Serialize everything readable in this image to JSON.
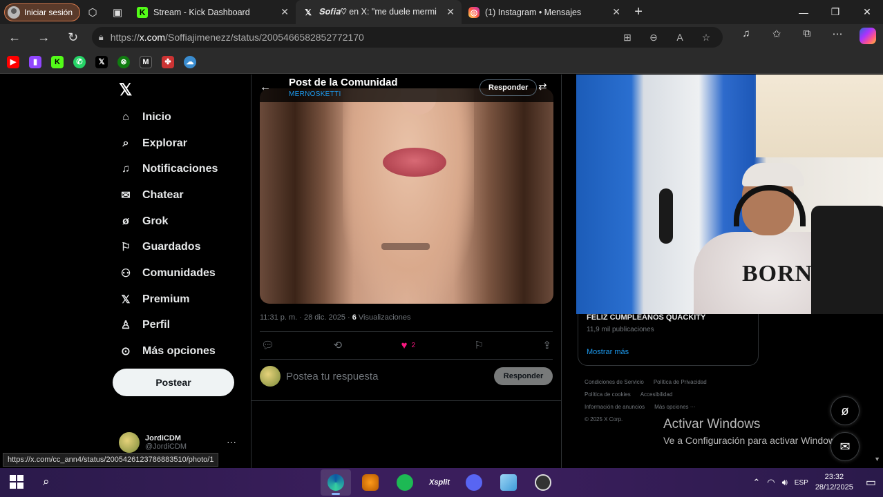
{
  "browser": {
    "profile_label": "Iniciar sesión",
    "tabs": [
      {
        "title": "Stream - Kick Dashboard",
        "favicon": "kick-icon",
        "active": false
      },
      {
        "title": "𝑺𝒐𝒇𝒊𝒂♡︎ en X: \"me duele mermi",
        "favicon": "x-icon",
        "active": true
      },
      {
        "title": "(1) Instagram • Mensajes",
        "favicon": "instagram-icon",
        "active": false
      }
    ],
    "url_prefix": "https://",
    "url_host": "x.com",
    "url_path": "/Soffiajimenezz/status/2005466582852772170",
    "bookmarks": [
      "youtube-icon",
      "twitch-icon",
      "kick-icon",
      "whatsapp-icon",
      "x-icon",
      "xbox-icon",
      "m-icon",
      "puzzle-icon",
      "cloud-icon"
    ],
    "status_url": "https://x.com/cc_ann4/status/2005426123786883510/photo/1"
  },
  "sidebar": {
    "items": [
      {
        "label": "Inicio",
        "icon": "home-icon"
      },
      {
        "label": "Explorar",
        "icon": "search-icon"
      },
      {
        "label": "Notificaciones",
        "icon": "bell-icon"
      },
      {
        "label": "Chatear",
        "icon": "mail-icon"
      },
      {
        "label": "Grok",
        "icon": "grok-icon"
      },
      {
        "label": "Guardados",
        "icon": "bookmark-icon"
      },
      {
        "label": "Comunidades",
        "icon": "people-icon"
      },
      {
        "label": "Premium",
        "icon": "x-icon"
      },
      {
        "label": "Perfil",
        "icon": "person-icon"
      },
      {
        "label": "Más opciones",
        "icon": "more-icon"
      }
    ],
    "post_button": "Postear",
    "account_name": "JordiCDM",
    "account_handle": "@JordiCDM"
  },
  "post": {
    "header_title": "Post de la Comunidad",
    "header_sub": "MERNOSKETTI",
    "reply_pill": "Responder",
    "time": "11:31 p. m. · 28 dic. 2025 · ",
    "views_count": "6",
    "views_label": " Visualizaciones",
    "likes": "2",
    "reply_placeholder": "Postea tu respuesta",
    "reply_button": "Responder"
  },
  "right": {
    "trend_title": "FELIZ CUMPLEAÑOS QUACKITY",
    "trend_count": "11,9 mil publicaciones",
    "show_more": "Mostrar más",
    "footer_links": [
      "Condiciones de Servicio",
      "Política de Privacidad",
      "Política de cookies",
      "Accesibilidad",
      "Información de anuncios",
      "Más opciones ···",
      "© 2025 X Corp."
    ],
    "activate_title": "Activar Windows",
    "activate_sub": "Ve a Configuración para activar Windows.",
    "cam_shirt_text": "BORN"
  },
  "taskbar": {
    "lang": "ESP",
    "time": "23:32",
    "date": "28/12/2025"
  },
  "colors": {
    "accent": "#1d9bf0",
    "like": "#f91880",
    "profile_border": "#d97b4c"
  }
}
